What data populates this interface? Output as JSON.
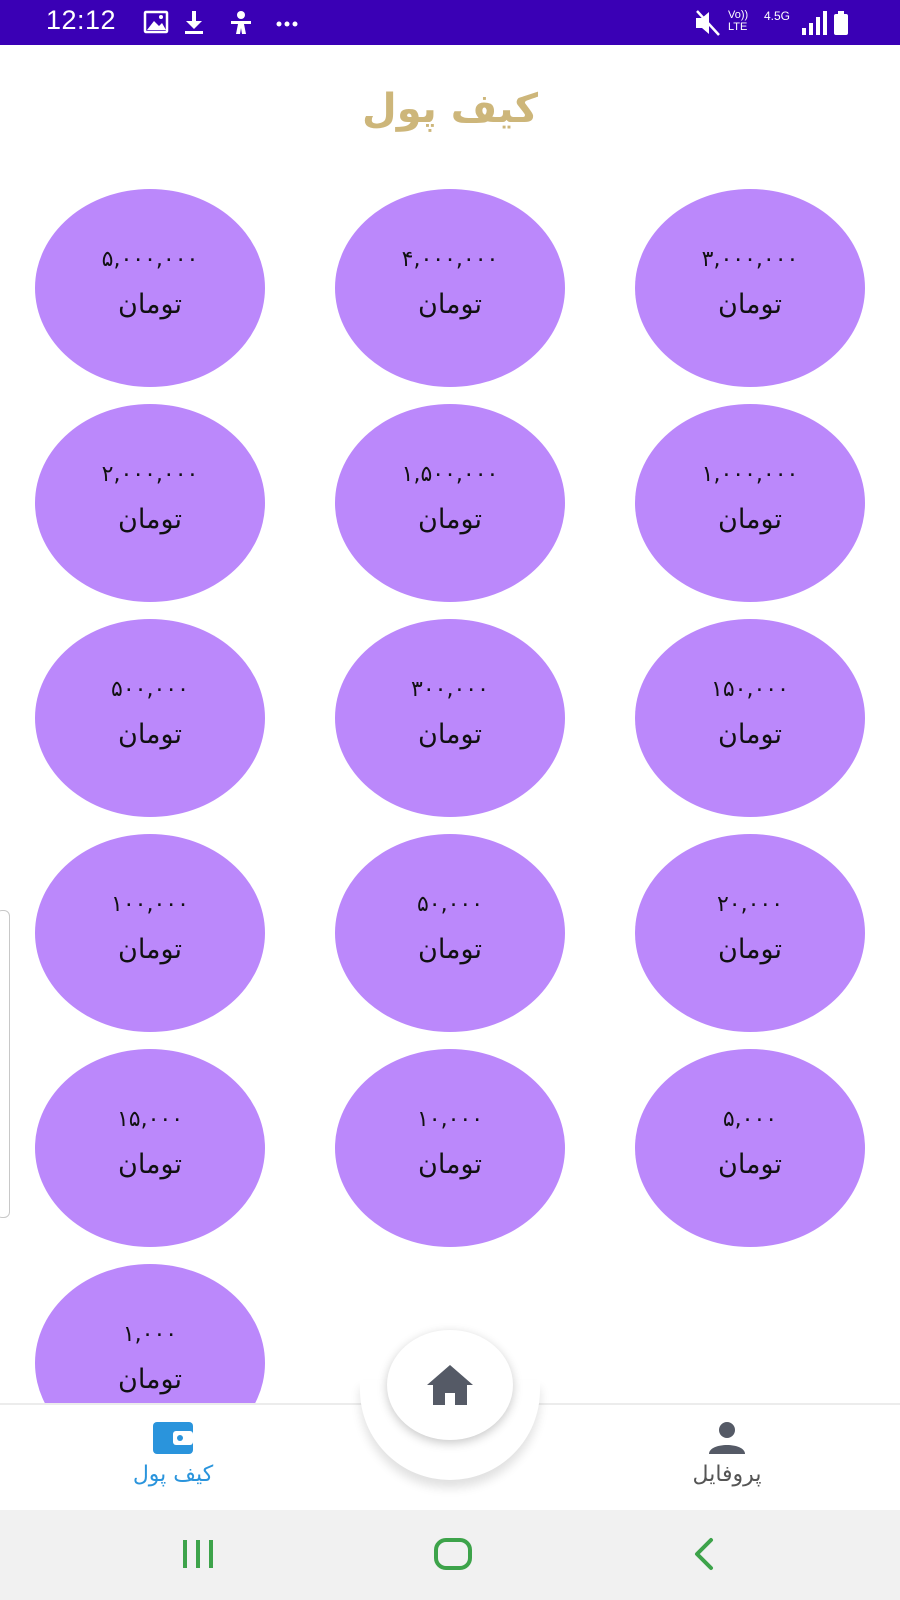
{
  "status_bar": {
    "time": "12:12",
    "left_icons": [
      "image-icon",
      "download-icon",
      "accessibility-icon",
      "more-dots-icon"
    ],
    "right_icons": [
      "mute-icon",
      "volte-icon",
      "data-4-5g-icon",
      "signal-icon",
      "battery-icon"
    ],
    "volte_label": "Vo)) LTE",
    "network_label": "4.5G",
    "bg_color": "#3a00b5"
  },
  "header": {
    "title": "کیف پول",
    "title_color": "#cdb67a"
  },
  "amounts": [
    {
      "value": "۵,۰۰۰,۰۰۰",
      "currency": "تومان"
    },
    {
      "value": "۴,۰۰۰,۰۰۰",
      "currency": "تومان"
    },
    {
      "value": "۳,۰۰۰,۰۰۰",
      "currency": "تومان"
    },
    {
      "value": "۲,۰۰۰,۰۰۰",
      "currency": "تومان"
    },
    {
      "value": "۱,۵۰۰,۰۰۰",
      "currency": "تومان"
    },
    {
      "value": "۱,۰۰۰,۰۰۰",
      "currency": "تومان"
    },
    {
      "value": "۵۰۰,۰۰۰",
      "currency": "تومان"
    },
    {
      "value": "۳۰۰,۰۰۰",
      "currency": "تومان"
    },
    {
      "value": "۱۵۰,۰۰۰",
      "currency": "تومان"
    },
    {
      "value": "۱۰۰,۰۰۰",
      "currency": "تومان"
    },
    {
      "value": "۵۰,۰۰۰",
      "currency": "تومان"
    },
    {
      "value": "۲۰,۰۰۰",
      "currency": "تومان"
    },
    {
      "value": "۱۵,۰۰۰",
      "currency": "تومان"
    },
    {
      "value": "۱۰,۰۰۰",
      "currency": "تومان"
    },
    {
      "value": "۵,۰۰۰",
      "currency": "تومان"
    },
    {
      "value": "۱,۰۰۰",
      "currency": "تومان"
    }
  ],
  "colors": {
    "amount_bubble": "#bb88fb",
    "nav_active": "#2a94dc",
    "nav_inactive": "#555555",
    "system_nav_icons": "#3da34a"
  },
  "bottom_nav": {
    "wallet_label": "کیف پول",
    "profile_label": "پروفایل",
    "home_icon": "home-icon",
    "active": "wallet"
  },
  "system_nav": {
    "icons": [
      "recents-icon",
      "home-pill-icon",
      "back-icon"
    ]
  }
}
